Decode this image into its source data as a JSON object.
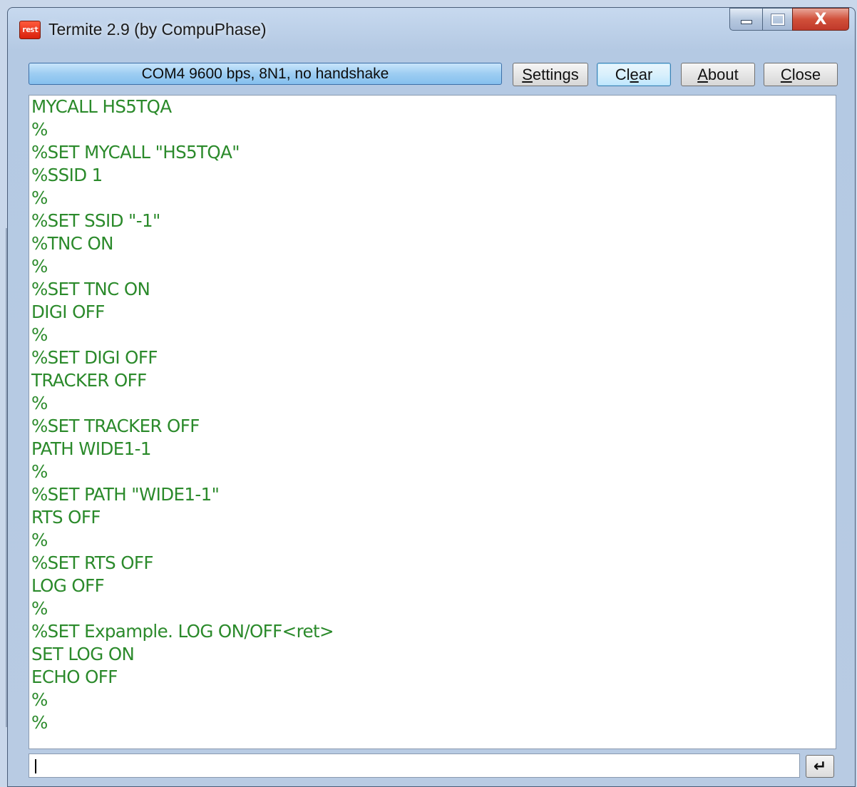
{
  "window": {
    "icon_text": "rest",
    "title": "Termite 2.9 (by CompuPhase)",
    "minimize_label": "",
    "maximize_label": "",
    "close_symbol": "X"
  },
  "toolbar": {
    "status": "COM4 9600 bps, 8N1, no handshake",
    "settings": {
      "mnemonic": "S",
      "rest": "ettings"
    },
    "clear": {
      "pre": "Cl",
      "mnemonic": "e",
      "rest": "ar"
    },
    "about": {
      "mnemonic": "A",
      "rest": "bout"
    },
    "close": {
      "mnemonic": "C",
      "rest": "lose"
    }
  },
  "terminal": {
    "text_color": "#2b8a2b",
    "lines": [
      "MYCALL HS5TQA",
      "%",
      "%SET MYCALL \"HS5TQA\"",
      "%SSID 1",
      "%",
      "%SET SSID \"-1\"",
      "%TNC ON",
      "%",
      "%SET TNC ON",
      "DIGI OFF",
      "%",
      "%SET DIGI OFF",
      "TRACKER OFF",
      "%",
      "%SET TRACKER OFF",
      "PATH WIDE1-1",
      "%",
      "%SET PATH \"WIDE1-1\"",
      "RTS OFF",
      "%",
      "%SET RTS OFF",
      "LOG OFF",
      "%",
      "%SET Expample. LOG ON/OFF<ret>",
      "SET LOG ON",
      "ECHO OFF",
      "%",
      "%"
    ]
  },
  "input": {
    "value": "",
    "enter_icon": "↵"
  }
}
